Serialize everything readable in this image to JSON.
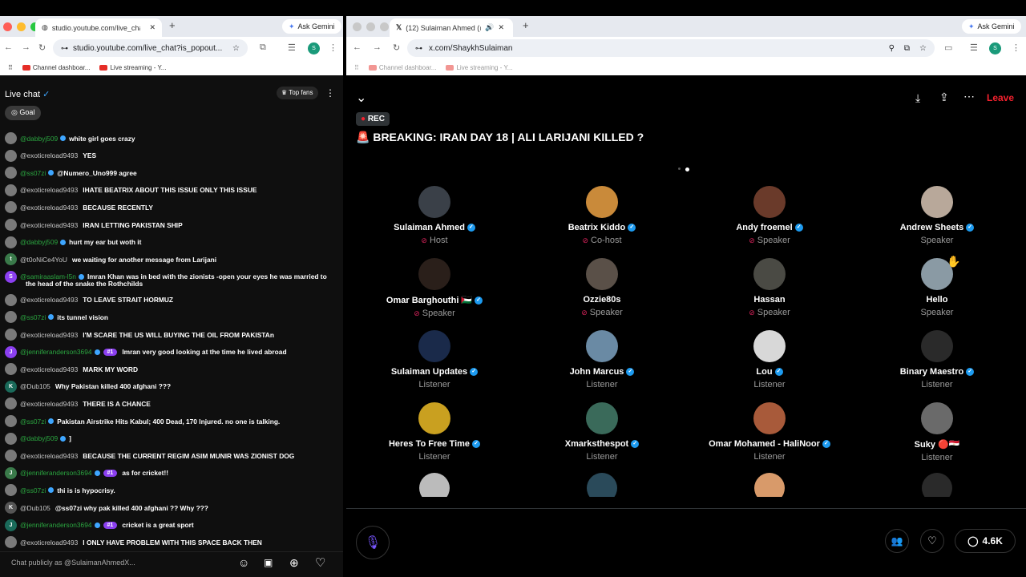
{
  "left_browser": {
    "tab_title": "studio.youtube.com/live_chat",
    "ask_gemini": "Ask Gemini",
    "url": "studio.youtube.com/live_chat?is_popout...",
    "profile": "S",
    "bookmarks": [
      "Channel dashboar...",
      "Live streaming - Y..."
    ]
  },
  "chat": {
    "title": "Live chat",
    "top_fans": "Top fans",
    "goal": "Goal",
    "input_placeholder": "Chat publicly as @SulaimanAhmedX...",
    "messages": [
      {
        "author": "@dabbyj509",
        "text": "white girl goes crazy",
        "green": true,
        "badge": true,
        "initial": ""
      },
      {
        "author": "@exoticreload9493",
        "text": "YES",
        "initial": ""
      },
      {
        "author": "@ss07zi",
        "text": "@Numero_Uno999 agree",
        "green": true,
        "badge": true,
        "initial": ""
      },
      {
        "author": "@exoticreload9493",
        "text": "IHATE BEATRIX ABOUT THIS ISSUE ONLY THIS ISSUE",
        "initial": ""
      },
      {
        "author": "@exoticreload9493",
        "text": "BECAUSE RECENTLY",
        "initial": ""
      },
      {
        "author": "@exoticreload9493",
        "text": "IRAN LETTING PAKISTAN SHIP",
        "initial": ""
      },
      {
        "author": "@dabbyj509",
        "text": "hurt my ear but woth it",
        "green": true,
        "badge": true,
        "initial": ""
      },
      {
        "author": "@t0oNiCe4YoU",
        "text": "we waiting for another message from Larijani",
        "initial": "t"
      },
      {
        "author": "@samiraaslam-l5n",
        "text": "Imran Khan was in bed with the zionists -open your eyes he was married to",
        "text2": "the head of the snake the Rothchilds",
        "green": true,
        "badge": true,
        "initial": "S"
      },
      {
        "author": "@exoticreload9493",
        "text": "TO LEAVE STRAIT HORMUZ",
        "initial": ""
      },
      {
        "author": "@ss07zi",
        "text": "its tunnel vision",
        "green": true,
        "badge": true,
        "initial": ""
      },
      {
        "author": "@exoticreload9493",
        "text": "I'M SCARE THE US WILL BUYING THE OIL FROM PAKISTAn",
        "initial": ""
      },
      {
        "author": "@jenniferanderson3694",
        "text": "Imran very good looking at the time he lived abroad",
        "green": true,
        "badge": true,
        "rank": "#1",
        "initial": "J"
      },
      {
        "author": "@exoticreload9493",
        "text": "MARK MY WORD",
        "initial": ""
      },
      {
        "author": "@Dub105",
        "text": "Why Pakistan killed 400 afghani ???",
        "initial": "K"
      },
      {
        "author": "@exoticreload9493",
        "text": "THERE IS A CHANCE",
        "initial": ""
      },
      {
        "author": "@ss07zi",
        "text": "Pakistan Airstrike Hits Kabul; 400 Dead, 170 Injured. no one is talking.",
        "green": true,
        "badge": true,
        "initial": ""
      },
      {
        "author": "@dabbyj509",
        "text": "]",
        "green": true,
        "badge": true,
        "initial": ""
      },
      {
        "author": "@exoticreload9493",
        "text": "BECAUSE THE CURRENT REGIM ASIM MUNIR WAS ZIONIST DOG",
        "initial": ""
      },
      {
        "author": "@jenniferanderson3694",
        "text": "as for cricket!!",
        "green": true,
        "badge": true,
        "rank": "#1",
        "initial": "J"
      },
      {
        "author": "@ss07zi",
        "text": "thi is is hypocrisy.",
        "green": true,
        "badge": true,
        "initial": ""
      },
      {
        "author": "@Dub105",
        "text": "@ss07zi why pak killed 400 afghani ?? Why ???",
        "initial": "K"
      },
      {
        "author": "@jenniferanderson3694",
        "text": "cricket is a great sport",
        "green": true,
        "badge": true,
        "rank": "#1",
        "initial": "J"
      },
      {
        "author": "@exoticreload9493",
        "text": "I ONLY HAVE PROBLEM WITH THIS SPACE BACK THEN",
        "initial": ""
      }
    ]
  },
  "right_browser": {
    "tab_title": "(12) Sulaiman Ahmed (@S",
    "ask_gemini": "Ask Gemini",
    "url": "x.com/ShaykhSulaiman",
    "profile": "S",
    "bookmarks": [
      "Channel dashboar...",
      "Live streaming - Y..."
    ]
  },
  "space": {
    "leave": "Leave",
    "rec": "REC",
    "title": "BREAKING: IRAN DAY 18 | ALI LARIJANI KILLED ?",
    "comment_count": "4.6K",
    "speakers": [
      {
        "name": "Sulaiman Ahmed",
        "role": "Host",
        "verified": true,
        "muted": true,
        "color": "#3a4048",
        "flag": ""
      },
      {
        "name": "Beatrix Kiddo",
        "role": "Co-host",
        "verified": true,
        "muted": true,
        "color": "#c98a3a",
        "flag": ""
      },
      {
        "name": "Andy froemel",
        "role": "Speaker",
        "verified": true,
        "muted": true,
        "color": "#6a3a2a",
        "flag": ""
      },
      {
        "name": "Andrew Sheets",
        "role": "Speaker",
        "verified": true,
        "muted": false,
        "color": "#b8a89a",
        "flag": ""
      },
      {
        "name": "Omar Barghouthi",
        "role": "Speaker",
        "verified": true,
        "muted": true,
        "color": "#2a1f1a",
        "flag": "🇵🇸"
      },
      {
        "name": "Ozzie80s",
        "role": "Speaker",
        "verified": false,
        "muted": true,
        "color": "#5a5048",
        "flag": ""
      },
      {
        "name": "Hassan",
        "role": "Speaker",
        "verified": false,
        "muted": true,
        "color": "#4a4a44",
        "flag": ""
      },
      {
        "name": "Hello",
        "role": "Speaker",
        "verified": false,
        "muted": false,
        "color": "#8a9aa4",
        "flag": "",
        "hand": "✋"
      },
      {
        "name": "Sulaiman Updates",
        "role": "Listener",
        "verified": true,
        "muted": false,
        "color": "#1a2a4a",
        "flag": ""
      },
      {
        "name": "John Marcus",
        "role": "Listener",
        "verified": true,
        "muted": false,
        "color": "#6a8aa4",
        "flag": ""
      },
      {
        "name": "Lou",
        "role": "Listener",
        "verified": true,
        "muted": false,
        "color": "#d8d8d8",
        "flag": ""
      },
      {
        "name": "Binary Maestro",
        "role": "Listener",
        "verified": true,
        "muted": false,
        "color": "#2a2a2a",
        "flag": ""
      },
      {
        "name": "Heres To Free Time",
        "role": "Listener",
        "verified": true,
        "muted": false,
        "color": "#c9a020",
        "flag": ""
      },
      {
        "name": "Xmarksthespot",
        "role": "Listener",
        "verified": true,
        "muted": false,
        "color": "#3a6a5a",
        "flag": ""
      },
      {
        "name": "Omar Mohamed - HaliNoor",
        "role": "Listener",
        "verified": true,
        "muted": false,
        "color": "#a85a3a",
        "flag": ""
      },
      {
        "name": "Suky",
        "role": "Listener",
        "verified": false,
        "muted": false,
        "color": "#6a6a6a",
        "flag": "🔴🇪🇬"
      }
    ]
  },
  "colors": {
    "accent_green": "#2ba640",
    "x_blue": "#1d9bf0",
    "leave_red": "#f4212e",
    "rank_purple": "#8b3ff0"
  }
}
